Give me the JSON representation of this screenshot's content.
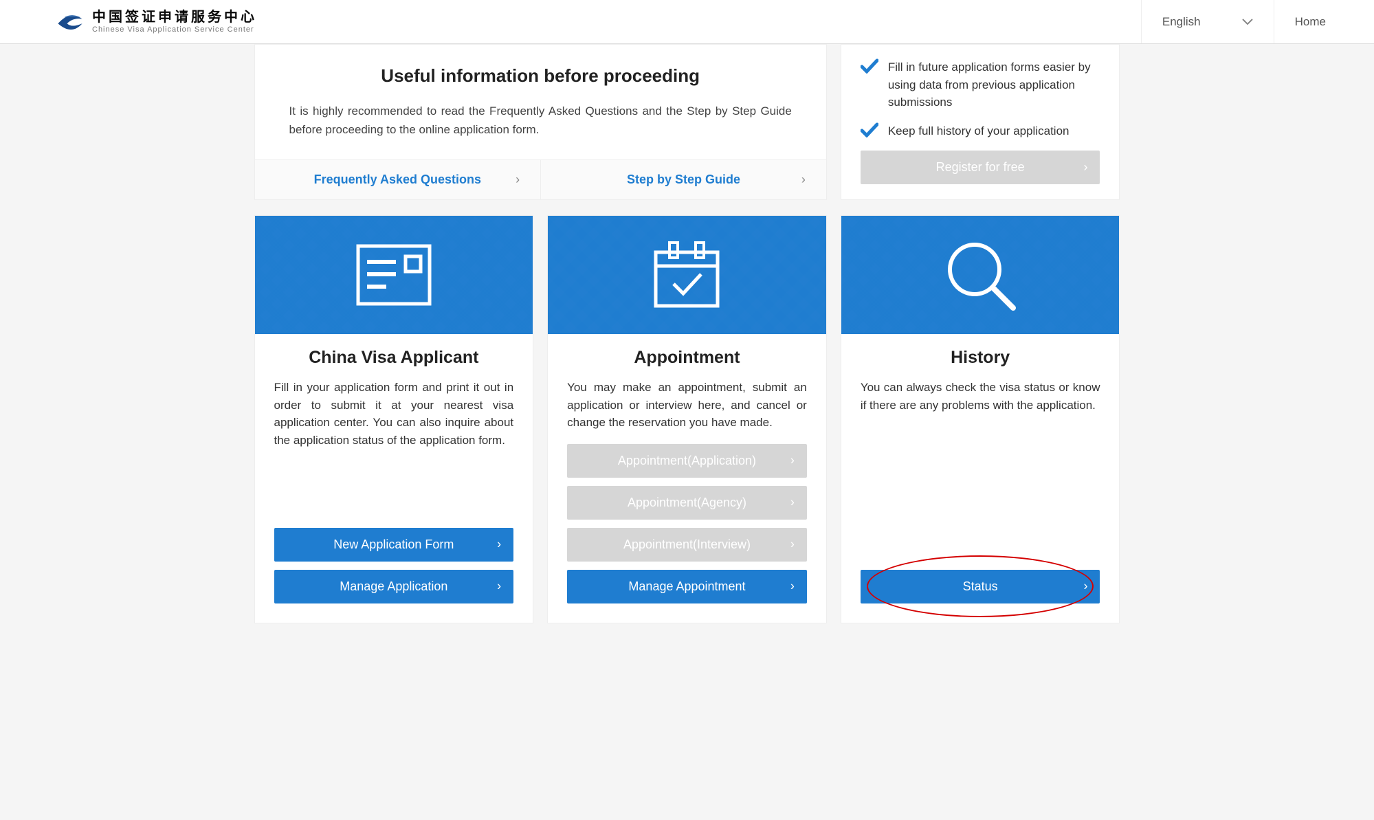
{
  "header": {
    "logo_cn": "中国签证申请服务中心",
    "logo_en": "Chinese Visa Application Service Center",
    "language": "English",
    "home": "Home"
  },
  "info": {
    "title": "Useful information before proceeding",
    "text": "It is highly recommended to read the Frequently Asked Questions and the Step by Step Guide before proceeding to the online application form.",
    "links": {
      "faq": "Frequently Asked Questions",
      "guide": "Step by Step Guide"
    }
  },
  "benefits": {
    "item1": "Fill in future application forms easier by using data from previous application submissions",
    "item2": "Keep full history of your application",
    "register_btn": "Register for free"
  },
  "cards": {
    "applicant": {
      "title": "China Visa Applicant",
      "text": "Fill in your application form and print it out in order to submit it at your nearest visa application center. You can also inquire about the application status of the application form.",
      "btn_new": "New Application Form",
      "btn_manage": "Manage Application"
    },
    "appointment": {
      "title": "Appointment",
      "text": "You may make an appointment, submit an application or interview here, and cancel or change the reservation you have made.",
      "btn_application": "Appointment(Application)",
      "btn_agency": "Appointment(Agency)",
      "btn_interview": "Appointment(Interview)",
      "btn_manage": "Manage Appointment"
    },
    "history": {
      "title": "History",
      "text": "You can always check the visa status or know if there are any problems with the application.",
      "btn_status": "Status"
    }
  }
}
